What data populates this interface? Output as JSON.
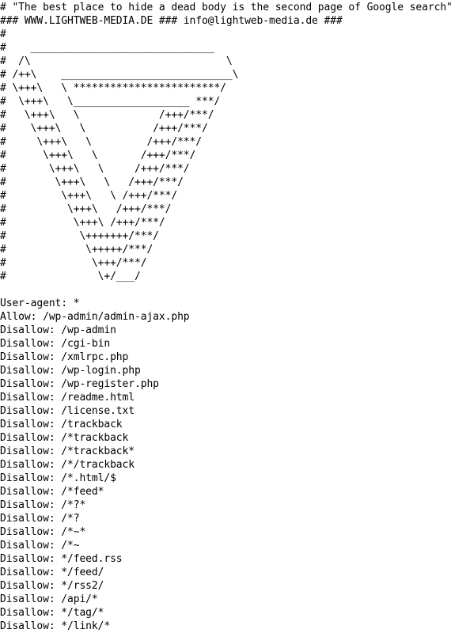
{
  "document": {
    "type": "robots.txt",
    "header_lines": [
      "# \"The best place to hide a dead body is the second page of Google search\"",
      "### WWW.LIGHTWEB-MEDIA.DE ### info@lightweb-media.de ###",
      "#"
    ],
    "ascii_art_lines": [
      "#    ______________________________",
      "#  /\\                                \\",
      "# /++\\    ____________________________\\",
      "# \\+++\\   \\ ************************/",
      "#  \\+++\\   \\___________________ ***/",
      "#   \\+++\\   \\             /+++/***/",
      "#    \\+++\\   \\           /+++/***/",
      "#     \\+++\\   \\         /+++/***/",
      "#      \\+++\\   \\       /+++/***/",
      "#       \\+++\\   \\     /+++/***/",
      "#        \\+++\\   \\   /+++/***/",
      "#         \\+++\\   \\ /+++/***/",
      "#          \\+++\\   /+++/***/",
      "#           \\+++\\ /+++/***/",
      "#            \\+++++++/***/",
      "#             \\+++++/***/",
      "#              \\+++/***/",
      "#               \\+/___/"
    ],
    "blank_line": " ",
    "rules": [
      "User-agent: *",
      "Allow: /wp-admin/admin-ajax.php",
      "Disallow: /wp-admin",
      "Disallow: /cgi-bin",
      "Disallow: /xmlrpc.php",
      "Disallow: /wp-login.php",
      "Disallow: /wp-register.php",
      "Disallow: /readme.html",
      "Disallow: /license.txt",
      "Disallow: /trackback",
      "Disallow: /*trackback",
      "Disallow: /*trackback*",
      "Disallow: /*/trackback",
      "Disallow: /*.html/$",
      "Disallow: /*feed*",
      "Disallow: /*?*",
      "Disallow: /*?",
      "Disallow: /*~*",
      "Disallow: /*~",
      "Disallow: */feed.rss",
      "Disallow: */feed/",
      "Disallow: */rss2/",
      "Disallow: /api/*",
      "Disallow: */tag/*",
      "Disallow: */link/*"
    ]
  }
}
